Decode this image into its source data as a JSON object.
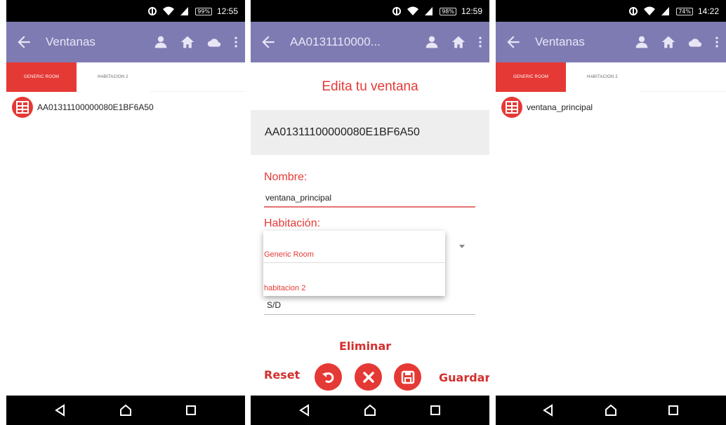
{
  "screens": {
    "list1": {
      "status": {
        "battery": "99%",
        "time": "12:55"
      },
      "toolbar": {
        "title": "Ventanas"
      },
      "tabs": [
        {
          "label": "GENERIC ROOM"
        },
        {
          "label": "HABITACION 2"
        }
      ],
      "items": [
        {
          "label": "AA01311100000080E1BF6A50"
        }
      ]
    },
    "edit": {
      "status": {
        "battery": "98%",
        "time": "12:59"
      },
      "toolbar": {
        "title": "AA0131110000..."
      },
      "heading": "Edita tu ventana",
      "device_id": "AA01311100000080E1BF6A50",
      "name_label": "Nombre:",
      "name_value": "ventana_principal",
      "room_label": "Habitación:",
      "room_options": [
        {
          "label": "Generic Room"
        },
        {
          "label": "habitacion 2"
        }
      ],
      "extra_value": "S/D",
      "actions": {
        "eliminar": "Eliminar",
        "reset": "Reset",
        "guardar": "Guardar"
      }
    },
    "list2": {
      "status": {
        "battery": "74%",
        "time": "14:22"
      },
      "toolbar": {
        "title": "Ventanas"
      },
      "tabs": [
        {
          "label": "GENERIC ROOM"
        },
        {
          "label": "HABITACION 2"
        }
      ],
      "items": [
        {
          "label": "ventana_principal"
        }
      ]
    }
  },
  "colors": {
    "accent": "#e53935",
    "toolbar": "#7e7bb3",
    "status_bar": "#000000"
  },
  "icons": [
    "back-arrow-icon",
    "person-icon",
    "home-icon",
    "cloud-icon",
    "more-vert-icon",
    "window-icon",
    "nav-back-icon",
    "nav-home-icon",
    "nav-recents-icon",
    "undo-icon",
    "close-icon",
    "save-icon"
  ]
}
